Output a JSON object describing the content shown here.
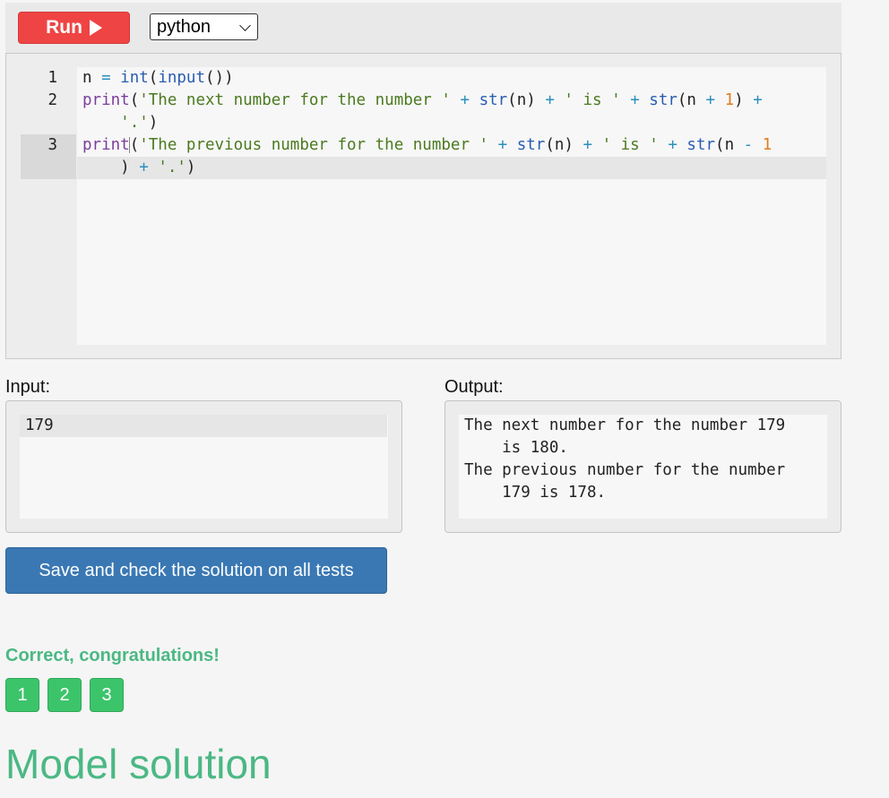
{
  "toolbar": {
    "run_label": "Run",
    "language": "python"
  },
  "editor": {
    "line_numbers": [
      "1",
      "2",
      "3"
    ],
    "lines": [
      "n = int(input())",
      "print('The next number for the number ' + str(n) + ' is ' + str(n + 1) + '.')",
      "print('The previous number for the number ' + str(n) + ' is ' + str(n - 1) + '.')"
    ],
    "active_line": 3
  },
  "io": {
    "input_label": "Input:",
    "input_value": "179",
    "output_label": "Output:",
    "output_lines": [
      "The next number for the number 179",
      "    is 180.",
      "The previous number for the number",
      "    179 is 178."
    ]
  },
  "actions": {
    "save_label": "Save and check the solution on all tests"
  },
  "result": {
    "message": "Correct, congratulations!",
    "tests": [
      "1",
      "2",
      "3"
    ],
    "color_success": "#4bb884"
  },
  "model_solution": {
    "title": "Model solution"
  }
}
